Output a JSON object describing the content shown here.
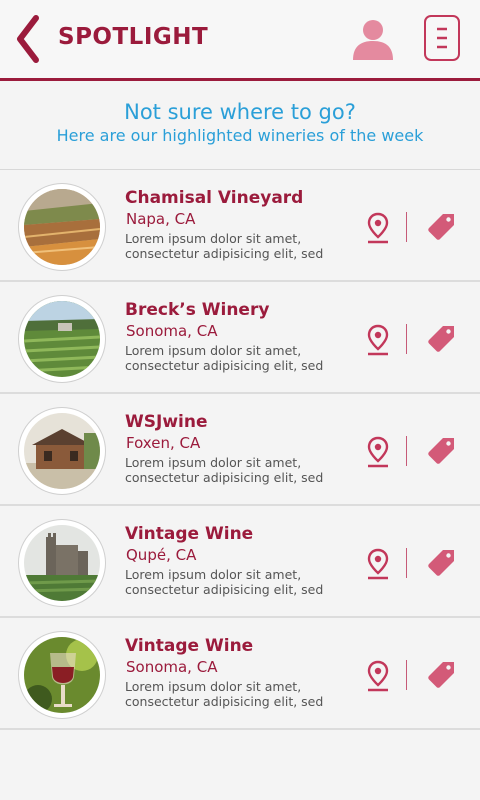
{
  "header": {
    "title": "SPOTLIGHT"
  },
  "intro": {
    "question": "Not sure where to go?",
    "subtitle": "Here are our highlighted wineries of the week"
  },
  "wineries": [
    {
      "name": "Chamisal Vineyard",
      "location": "Napa, CA",
      "description": "Lorem ipsum dolor sit amet, consectetur adipisicing elit, sed",
      "image": "vineyard-landscape"
    },
    {
      "name": "Breck’s Winery",
      "location": "Sonoma, CA",
      "description": "Lorem ipsum dolor sit amet, consectetur adipisicing elit, sed",
      "image": "vineyard-rows"
    },
    {
      "name": "WSJwine",
      "location": "Foxen, CA",
      "description": "Lorem ipsum dolor sit amet, consectetur adipisicing elit, sed",
      "image": "winery-cabin"
    },
    {
      "name": "Vintage Wine",
      "location": "Qupé, CA",
      "description": "Lorem ipsum dolor sit amet, consectetur adipisicing elit, sed",
      "image": "castle-vineyard"
    },
    {
      "name": "Vintage Wine",
      "location": "Sonoma, CA",
      "description": "Lorem ipsum dolor sit amet, consectetur adipisicing elit, sed",
      "image": "wine-glass"
    }
  ],
  "colors": {
    "brand": "#9b1b3c",
    "accent": "#c2375a",
    "intro_text": "#2a9fd8",
    "background": "#f4f4f4"
  },
  "icons": {
    "back": "chevron-left-icon",
    "user": "user-icon",
    "menu": "menu-icon",
    "location": "location-pin-icon",
    "tag": "tag-icon"
  }
}
